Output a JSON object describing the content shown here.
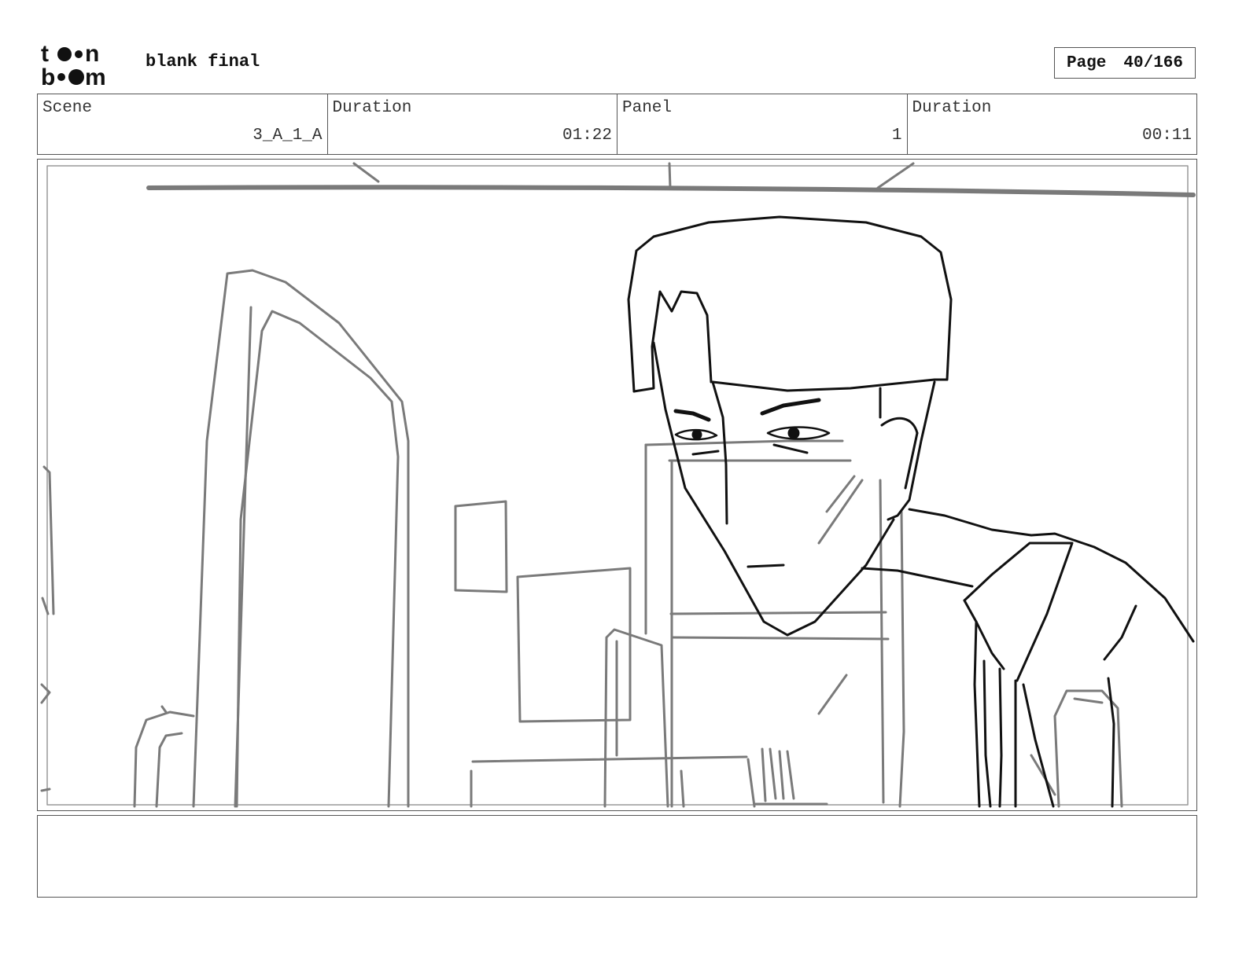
{
  "header": {
    "logo_text": "toon boom",
    "doc_title": "blank final",
    "page_label": "Page",
    "page_value": "40/166"
  },
  "info": {
    "scene_label": "Scene",
    "scene_value": "3_A_1_A",
    "duration_label": "Duration",
    "duration_value": "01:22",
    "panel_label": "Panel",
    "panel_value": "1",
    "panel_duration_label": "Duration",
    "panel_duration_value": "00:11"
  },
  "notes": {
    "text": ""
  }
}
